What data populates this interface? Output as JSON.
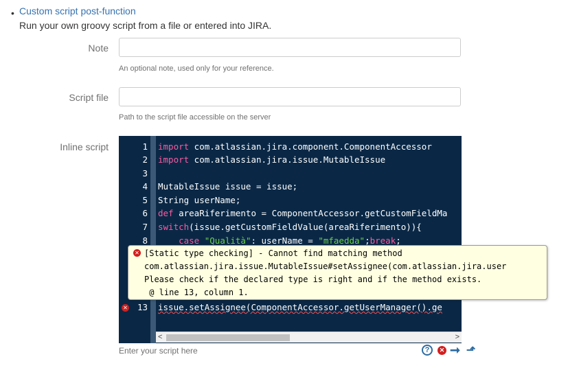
{
  "header": {
    "bullet": "•",
    "title_link": "Custom script post-function",
    "description": "Run your own groovy script from a file or entered into JIRA."
  },
  "fields": {
    "note": {
      "label": "Note",
      "value": "",
      "help": "An optional note, used only for your reference."
    },
    "script_file": {
      "label": "Script file",
      "value": "",
      "help": "Path to the script file accessible on the server"
    },
    "inline_script": {
      "label": "Inline script",
      "help": "Enter your script here"
    }
  },
  "editor": {
    "lines": [
      {
        "no": "1",
        "parts": [
          {
            "t": "kw",
            "v": "import"
          },
          {
            "t": "plain",
            "v": " com.atlassian.jira.component.ComponentAccessor"
          }
        ]
      },
      {
        "no": "2",
        "parts": [
          {
            "t": "kw",
            "v": "import"
          },
          {
            "t": "plain",
            "v": " com.atlassian.jira.issue.MutableIssue"
          }
        ]
      },
      {
        "no": "3",
        "parts": []
      },
      {
        "no": "4",
        "parts": [
          {
            "t": "plain",
            "v": "MutableIssue issue = issue;"
          }
        ]
      },
      {
        "no": "5",
        "parts": [
          {
            "t": "plain",
            "v": "String userName;"
          }
        ]
      },
      {
        "no": "6",
        "parts": [
          {
            "t": "kw",
            "v": "def"
          },
          {
            "t": "plain",
            "v": " areaRiferimento = ComponentAccessor.getCustomFieldMa"
          }
        ]
      },
      {
        "no": "7",
        "parts": [
          {
            "t": "kw",
            "v": "switch"
          },
          {
            "t": "plain",
            "v": "(issue.getCustomFieldValue(areaRiferimento)){"
          }
        ]
      },
      {
        "no": "8",
        "parts": [
          {
            "t": "plain",
            "v": "    "
          },
          {
            "t": "kw",
            "v": "case"
          },
          {
            "t": "plain",
            "v": " "
          },
          {
            "t": "str",
            "v": "\"Qualità\""
          },
          {
            "t": "plain",
            "v": ": userName = "
          },
          {
            "t": "str",
            "v": "\"mfaedda\""
          },
          {
            "t": "plain",
            "v": ";"
          },
          {
            "t": "kw",
            "v": "break"
          },
          {
            "t": "plain",
            "v": ";"
          }
        ]
      },
      {
        "no": "13",
        "error": true,
        "parts": [
          {
            "t": "err",
            "v": "issue.setAssignee(ComponentAccessor.getUserManager().ge"
          }
        ]
      }
    ]
  },
  "error_tooltip": {
    "lines": [
      "[Static type checking] - Cannot find matching method",
      "com.atlassian.jira.issue.MutableIssue#setAssignee(com.atlassian.jira.user",
      "Please check if the declared type is right and if the method exists.",
      " @ line 13, column 1."
    ]
  },
  "scroll_arrows": {
    "left": "<",
    "right": ">"
  },
  "icons": [
    "help-icon",
    "error-icon",
    "next-error-icon",
    "previous-error-icon"
  ],
  "colors": {
    "link": "#3572b0",
    "editor_bg": "#0a2846",
    "keyword": "#ff5aa0",
    "string": "#6fd24c",
    "tooltip_bg": "#ffffe1",
    "error": "#d21f1f"
  }
}
